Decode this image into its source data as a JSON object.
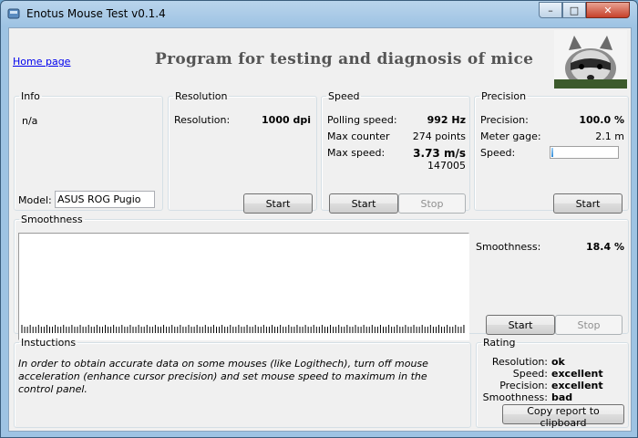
{
  "window": {
    "title": "Enotus Mouse Test v0.1.4",
    "minimize": "–",
    "maximize": "□",
    "close": "✕"
  },
  "header": {
    "home_link": "Home page",
    "heading": "Program for testing and diagnosis of mice"
  },
  "info": {
    "legend": "Info",
    "text": "n/a",
    "model_label": "Model:",
    "model_value": "ASUS ROG Pugio"
  },
  "resolution": {
    "legend": "Resolution",
    "label": "Resolution:",
    "value": "1000 dpi",
    "start": "Start"
  },
  "speed": {
    "legend": "Speed",
    "polling_label": "Polling speed:",
    "polling_value": "992 Hz",
    "counter_label": "Max counter",
    "counter_value": "274 points",
    "max_speed_label": "Max  speed:",
    "max_speed_value": "3.73 m/s",
    "max_speed_sub": "147005",
    "start": "Start",
    "stop": "Stop"
  },
  "precision": {
    "legend": "Precision",
    "precision_label": "Precision:",
    "precision_value": "100.0 %",
    "gage_label": "Meter gage:",
    "gage_value": "2.1 m",
    "speed_label": "Speed:",
    "speed_level": 0.03,
    "start": "Start"
  },
  "smoothness": {
    "legend": "Smoothness",
    "label": "Smoothness:",
    "value": "18.4 %",
    "start": "Start",
    "stop": "Stop",
    "tick_count": 160
  },
  "instructions": {
    "legend": "Instuctions",
    "text": "In order to obtain accurate data on some mouses (like Logithech), turn off mouse acceleration (enhance cursor precision) and set mouse speed to maximum in the control panel."
  },
  "rating": {
    "legend": "Rating",
    "rows": [
      {
        "label": "Resolution:",
        "value": "ok"
      },
      {
        "label": "Speed:",
        "value": "excellent"
      },
      {
        "label": "Precision:",
        "value": "excellent"
      },
      {
        "label": "Smoothness:",
        "value": "bad"
      }
    ],
    "copy_button": "Copy report to clipboard"
  },
  "colors": {
    "title_bar": "#9ec3e3",
    "client_bg": "#f0f0f0",
    "link": "#0000ee",
    "progress": "#2f8bd6"
  }
}
